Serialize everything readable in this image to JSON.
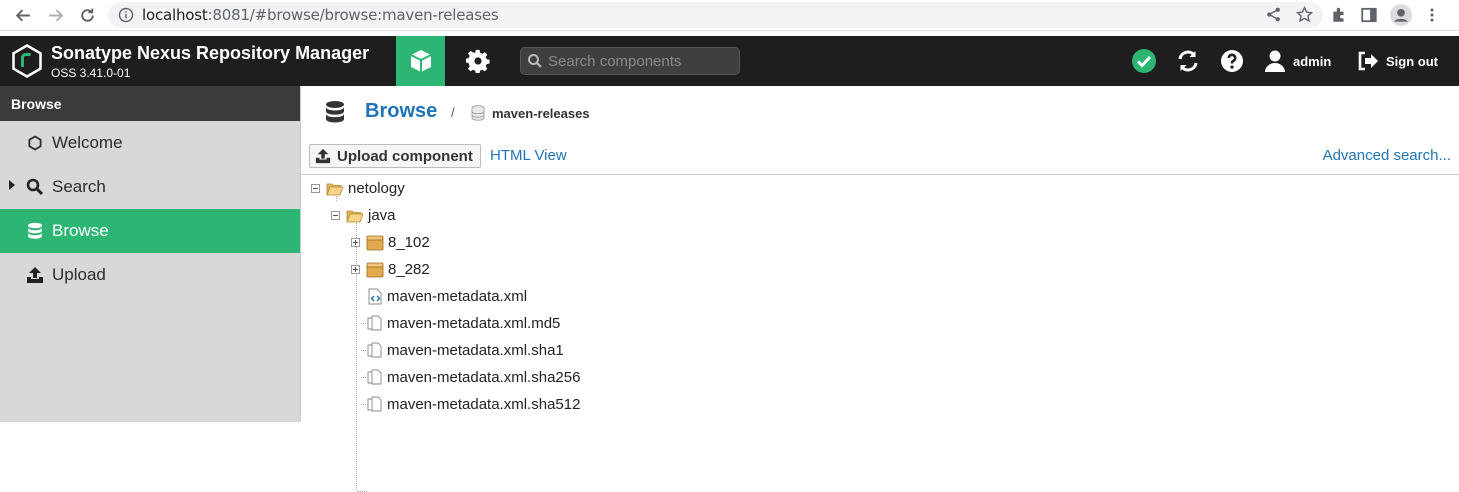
{
  "browser": {
    "url_host": "localhost",
    "url_rest": ":8081/#browse/browse:maven-releases"
  },
  "header": {
    "title": "Sonatype Nexus Repository Manager",
    "version": "OSS 3.41.0-01",
    "search_placeholder": "Search components",
    "user": "admin",
    "signout": "Sign out",
    "status_color": "#2cb573"
  },
  "sidebar": {
    "heading": "Browse",
    "items": [
      {
        "label": "Welcome",
        "icon": "hexagon-icon",
        "active": false
      },
      {
        "label": "Search",
        "icon": "search-icon",
        "active": false
      },
      {
        "label": "Browse",
        "icon": "database-icon",
        "active": true
      },
      {
        "label": "Upload",
        "icon": "upload-icon",
        "active": false
      }
    ]
  },
  "main": {
    "breadcrumb_title": "Browse",
    "breadcrumb_sep": "/",
    "breadcrumb_repo": "maven-releases",
    "upload_button": "Upload component",
    "html_view": "HTML View",
    "advanced_search": "Advanced search...",
    "tree": [
      {
        "label": "netology",
        "type": "folder-open"
      },
      {
        "label": "java",
        "type": "folder-open"
      },
      {
        "label": "8_102",
        "type": "component"
      },
      {
        "label": "8_282",
        "type": "component"
      },
      {
        "label": "maven-metadata.xml",
        "type": "xml-file"
      },
      {
        "label": "maven-metadata.xml.md5",
        "type": "file"
      },
      {
        "label": "maven-metadata.xml.sha1",
        "type": "file"
      },
      {
        "label": "maven-metadata.xml.sha256",
        "type": "file"
      },
      {
        "label": "maven-metadata.xml.sha512",
        "type": "file"
      }
    ]
  }
}
